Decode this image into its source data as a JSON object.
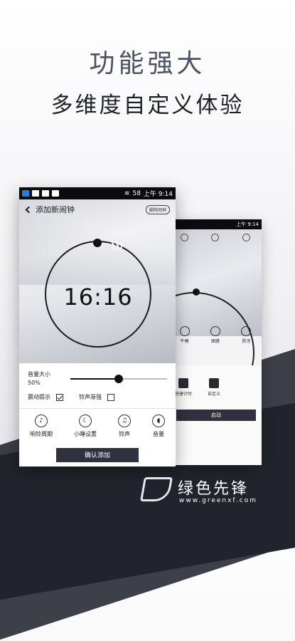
{
  "headline": {
    "title": "功能强大",
    "subtitle": "多维度自定义体验"
  },
  "back_phone": {
    "tabs": [
      "",
      "",
      ""
    ],
    "modes": [
      "午睡",
      "面膜",
      "煲汤"
    ],
    "actions": [
      "快捷计时",
      "自定义"
    ],
    "start_label": "启动"
  },
  "front_phone": {
    "status": {
      "time": "上午 9:14",
      "battery": "58"
    },
    "nav": {
      "title": "添加新闹钟",
      "delete_label": "删除闹钟"
    },
    "clock": {
      "time": "16:16"
    },
    "volume": {
      "label": "音量大小",
      "value_text": "50%",
      "level": 0.5
    },
    "options": {
      "vibrate": "震动提示",
      "vibrate_on": true,
      "fade": "铃声渐强",
      "fade_on": false
    },
    "tools": [
      {
        "label": "响铃周期",
        "icon": "bell-icon"
      },
      {
        "label": "小睡设置",
        "icon": "moon-icon"
      },
      {
        "label": "铃声",
        "icon": "music-note-icon"
      },
      {
        "label": "音量",
        "icon": "speaker-icon"
      }
    ],
    "confirm_label": "确认添加"
  },
  "watermark": {
    "name": "绿色先锋",
    "url": "www.greenxf.com"
  },
  "colors": {
    "accent_dark": "#2f3140",
    "background": "#f1f1f4"
  }
}
